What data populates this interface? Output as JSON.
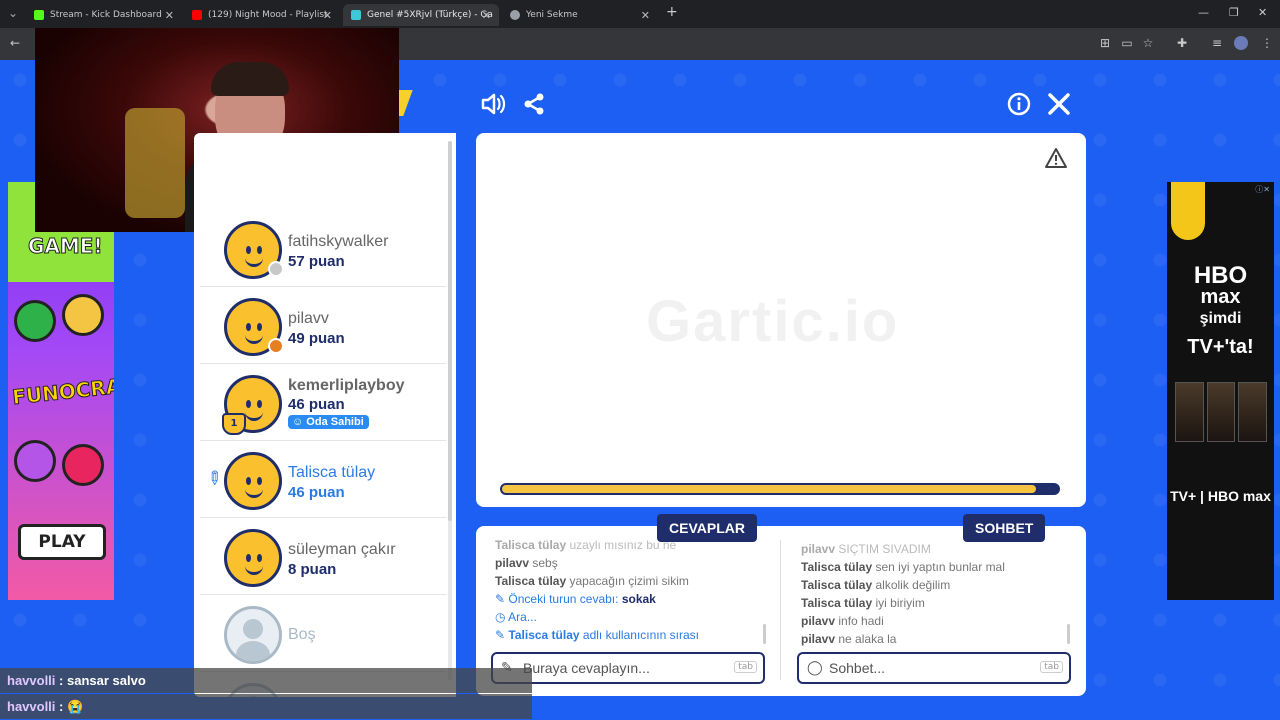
{
  "browser": {
    "tabs": [
      {
        "title": "Stream - Kick Dashboard",
        "fav_color": "#53fc18",
        "active": false
      },
      {
        "title": "(129) Night Mood - Playlist",
        "fav_color": "#ff0000",
        "active": false
      },
      {
        "title": "Genel #5XRjvl (Türkçe) - Ga",
        "fav_color": "#3ec7d6",
        "active": true
      },
      {
        "title": "Yeni Sekme",
        "fav_color": "#9aa0a6",
        "active": false
      }
    ]
  },
  "players": [
    {
      "name": "fatihskywalker",
      "score": "57 puan",
      "status_color": "#c8c8c8"
    },
    {
      "name": "pilavv",
      "score": "49 puan",
      "status_color": "#e67e22"
    },
    {
      "name": "kemerliplayboy",
      "score": "46 puan",
      "badge": "Oda Sahibi",
      "trophy": "1"
    },
    {
      "name": "Talisca tülay",
      "score": "46 puan",
      "drawing": true
    },
    {
      "name": "süleyman çakır",
      "score": "8 puan"
    },
    {
      "name": "Boş",
      "empty": true
    }
  ],
  "canvas": {
    "watermark": "Gartic.io",
    "timer_fraction": 0.96
  },
  "answers": {
    "tag": "CEVAPLAR",
    "messages": [
      {
        "user": "Talisca tülay",
        "text": "uzaylı mısınız bu ne",
        "faded": true
      },
      {
        "user": "pilavv",
        "text": "sebş"
      },
      {
        "user": "Talisca tülay",
        "text": "yapacağın çizimi sikim"
      },
      {
        "sys": "Önceki turun cevabı:",
        "value": "sokak",
        "icon": "pencil"
      },
      {
        "sys": "Ara...",
        "icon": "clock"
      },
      {
        "user": "Talisca tülay",
        "text": "adlı kullanıcının sırası",
        "sys_user": true
      }
    ],
    "placeholder": "Buraya cevaplayın...",
    "tab_hint": "tab"
  },
  "chat": {
    "tag": "SOHBET",
    "messages": [
      {
        "user": "pilavv",
        "text": "SIÇTIM SIVADIM",
        "faded": true
      },
      {
        "user": "Talisca tülay",
        "text": "sen iyi yaptın bunlar mal"
      },
      {
        "user": "Talisca tülay",
        "text": "alkolik değilim"
      },
      {
        "user": "Talisca tülay",
        "text": "iyi biriyim"
      },
      {
        "user": "pilavv",
        "text": "info hadi"
      },
      {
        "user": "pilavv",
        "text": "ne alaka la"
      }
    ],
    "placeholder": "Sohbet...",
    "tab_hint": "tab"
  },
  "stream_chat": [
    {
      "user": "havvolli",
      "text": ": sansar salvo"
    },
    {
      "user": "havvolli",
      "text": ": 😭"
    }
  ],
  "left_ad": {
    "line1": "GAME!",
    "line2": "FUNOCRACY",
    "button": "PLAY"
  },
  "right_ad": {
    "line1": "HBO",
    "line2": "max",
    "line3": "şimdi",
    "line4": "TV+'ta!",
    "line5": "TV+ | HBO max"
  },
  "colors": {
    "accent": "#1f2d6b",
    "brand_blue": "#1d5ff2",
    "timer": "#f5c542"
  }
}
